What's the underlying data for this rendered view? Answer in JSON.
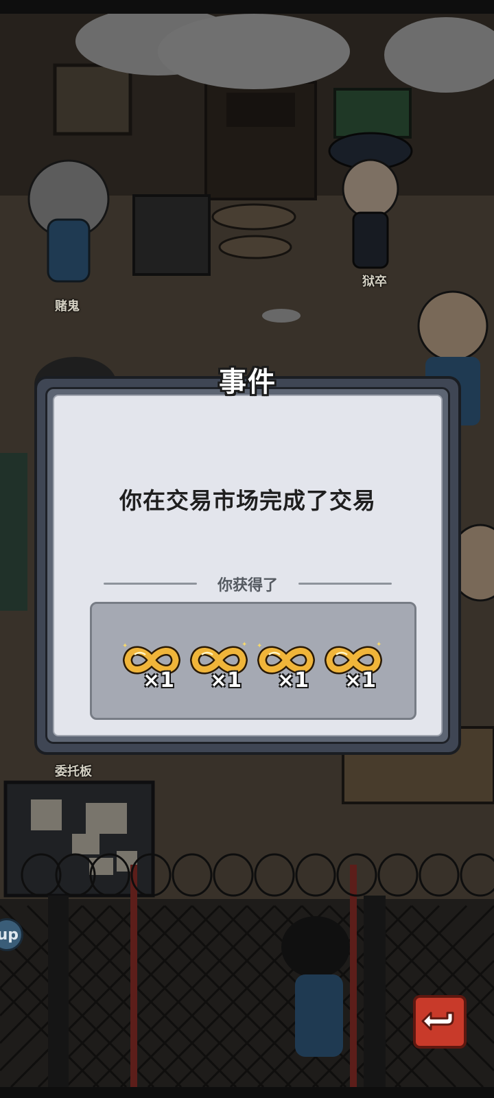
{
  "scene": {
    "labels": {
      "gambler": "赌鬼",
      "guard": "狱卒",
      "bulletin_board": "委托板"
    },
    "side_button": "up"
  },
  "dialog": {
    "title": "事件",
    "message": "你在交易市场完成了交易",
    "reward_header": "你获得了",
    "rewards": [
      {
        "icon": "golden-infinity-icon",
        "quantity": "×1"
      },
      {
        "icon": "golden-infinity-icon",
        "quantity": "×1"
      },
      {
        "icon": "golden-infinity-icon",
        "quantity": "×1"
      },
      {
        "icon": "golden-infinity-icon",
        "quantity": "×1"
      }
    ]
  },
  "colors": {
    "reward_gold": "#f0b53a",
    "back_button": "#c83a2a"
  }
}
